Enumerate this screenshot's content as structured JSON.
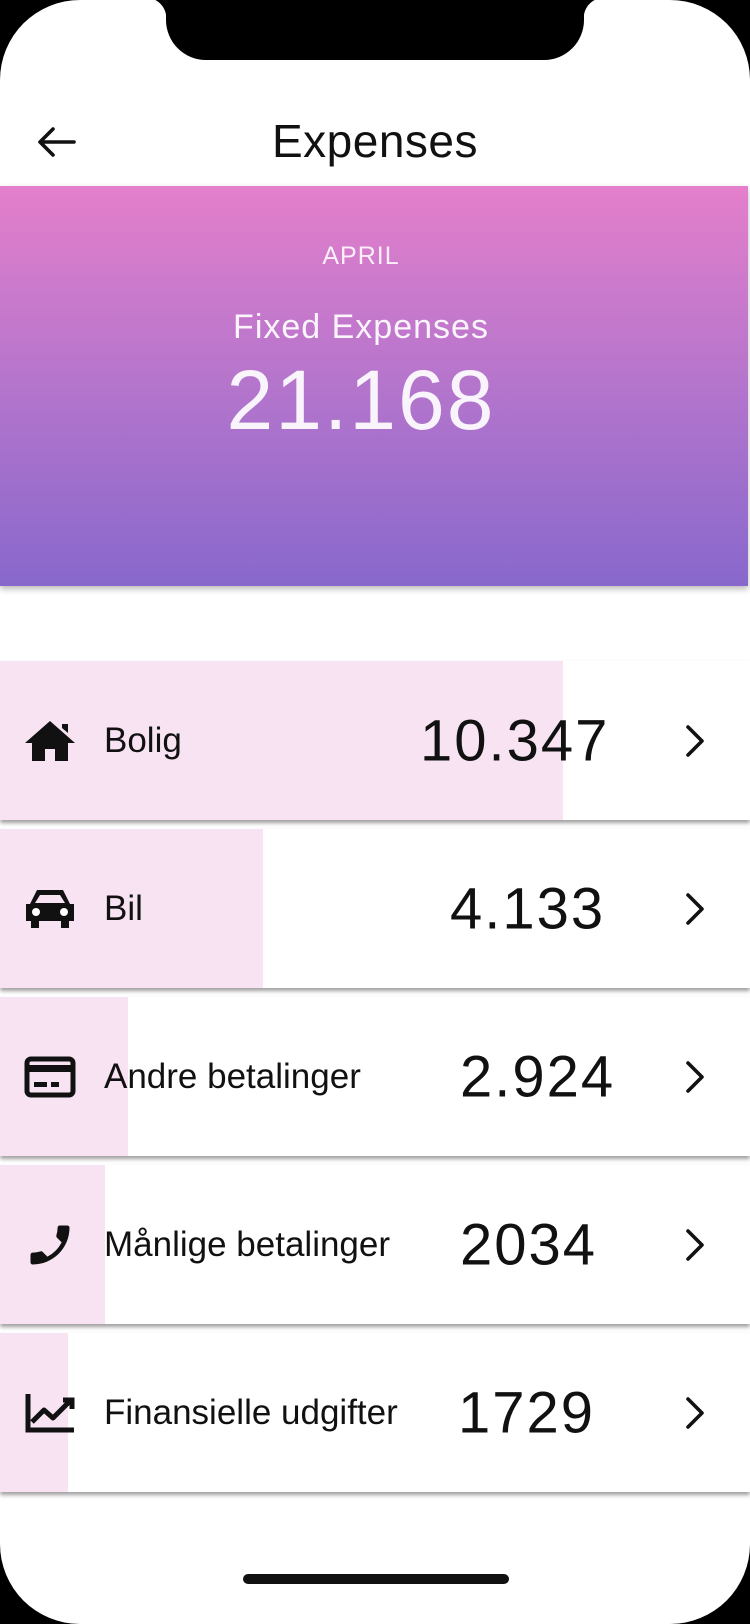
{
  "header": {
    "title": "Expenses",
    "back_icon": "arrow-left-icon"
  },
  "summary": {
    "month": "APRIL",
    "label": "Fixed Expenses",
    "total": "21.168"
  },
  "colors": {
    "gradient_top": "#e47fcb",
    "gradient_bottom": "#8868cc",
    "bar_fill": "#f8e3f3"
  },
  "categories": [
    {
      "icon": "home-icon",
      "label": "Bolig",
      "value": "10.347",
      "share": 0.75
    },
    {
      "icon": "car-icon",
      "label": "Bil",
      "value": "4.133",
      "share": 0.35
    },
    {
      "icon": "credit-card-icon",
      "label": "Andre betalinger",
      "value": "2.924",
      "share": 0.17
    },
    {
      "icon": "phone-icon",
      "label": "Månlige betalinger",
      "value": "2034",
      "share": 0.14
    },
    {
      "icon": "trending-up-icon",
      "label": "Finansielle udgifter",
      "value": "1729",
      "share": 0.09
    }
  ]
}
